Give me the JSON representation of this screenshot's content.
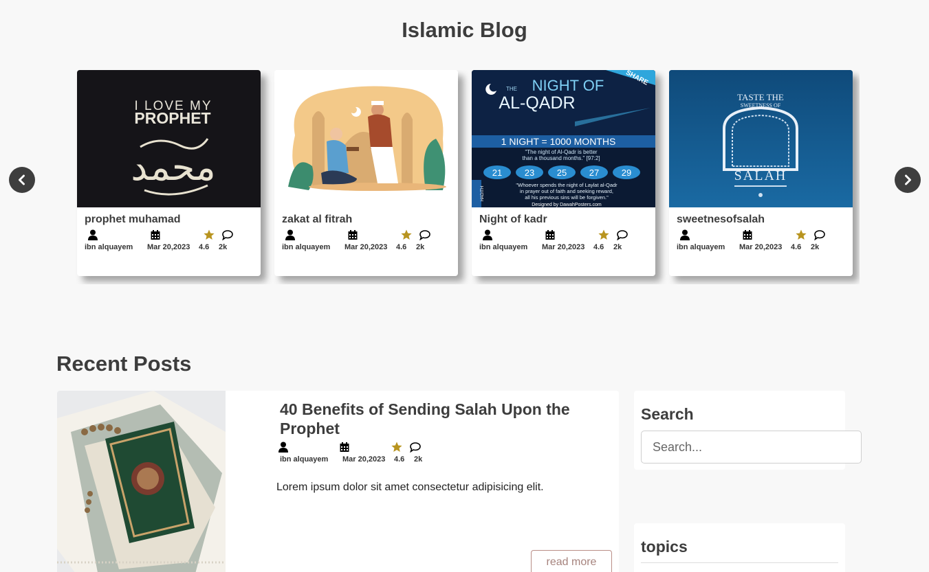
{
  "page": {
    "title": "Islamic Blog"
  },
  "carousel": {
    "cards": [
      {
        "title": "prophet muhamad",
        "author": "ibn alquayem",
        "date": "Mar 20,2023",
        "rating": "4.6",
        "comments": "2k",
        "image_text": {
          "line1": "I LOVE MY",
          "line2": "PROPHET",
          "arabic": "محمد"
        }
      },
      {
        "title": "zakat al fitrah",
        "author": "ibn alquayem",
        "date": "Mar 20,2023",
        "rating": "4.6",
        "comments": "2k"
      },
      {
        "title": "Night of kadr",
        "author": "ibn alquayem",
        "date": "Mar 20,2023",
        "rating": "4.6",
        "comments": "2k",
        "image_text": {
          "banner": "SHARE",
          "the": "THE",
          "heading1": "NIGHT OF",
          "heading2": "AL-QADR",
          "band": "1 NIGHT = 1000 MONTHS",
          "quote1": "\"The night of Al-Qadr is better",
          "quote2": "than a thousand months.\" [97:2]",
          "nights": [
            "21",
            "23",
            "25",
            "27",
            "29"
          ],
          "hadith1": "\"Whoever spends the night of Laylat al-Qadr",
          "hadith2": "in prayer out of faith and seeking reward,",
          "hadith3": "all his previous sins will be forgiven.\"",
          "side": "HADITH",
          "credit": "Designed by DawahPosters.com"
        }
      },
      {
        "title": "sweetnesofsalah",
        "author": "ibn alquayem",
        "date": "Mar 20,2023",
        "rating": "4.6",
        "comments": "2k",
        "image_text": {
          "line1": "TASTE THE",
          "line2": "SWEETNESS OF",
          "line3": "SALAH"
        }
      }
    ]
  },
  "recent": {
    "heading": "Recent Posts",
    "posts": [
      {
        "title": "40 Benefits of Sending Salah Upon the Prophet",
        "author": "ibn alquayem",
        "date": "Mar 20,2023",
        "rating": "4.6",
        "comments": "2k",
        "excerpt": "Lorem ipsum dolor sit amet consectetur adipisicing elit.",
        "read_more": "read more"
      }
    ]
  },
  "sidebar": {
    "search": {
      "title": "Search",
      "placeholder": "Search..."
    },
    "topics": {
      "title": "topics"
    }
  },
  "colors": {
    "star": "#b8941f",
    "arrow_bg": "#3e3e3e",
    "read_more_border": "#b98d86"
  }
}
